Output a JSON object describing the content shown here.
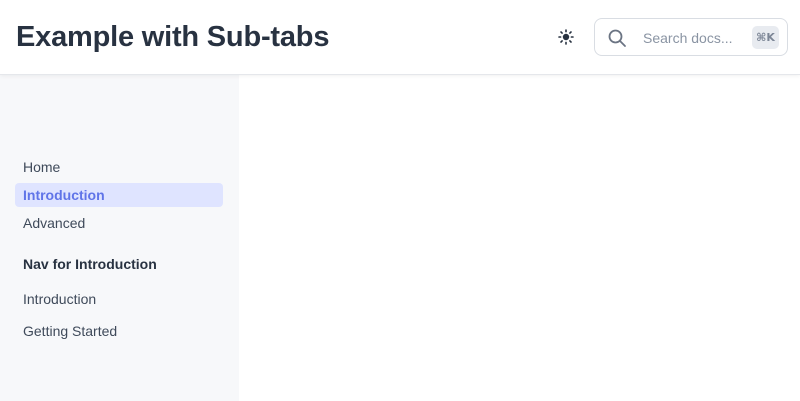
{
  "header": {
    "title": "Example with Sub-tabs",
    "theme_icon": "sun-icon",
    "search": {
      "placeholder": "Search docs...",
      "shortcut": "⌘K",
      "icon": "search-icon"
    }
  },
  "sidebar": {
    "tabs": [
      {
        "label": "Home"
      },
      {
        "label": "Introduction",
        "active": true
      },
      {
        "label": "Advanced"
      }
    ],
    "section_title": "Nav for Introduction",
    "section_items": [
      {
        "label": "Introduction"
      },
      {
        "label": "Getting Started"
      }
    ]
  },
  "colors": {
    "accent": "#6074e8",
    "active_bg": "#dfe4ff",
    "sidebar_bg": "#f7f8fa"
  }
}
